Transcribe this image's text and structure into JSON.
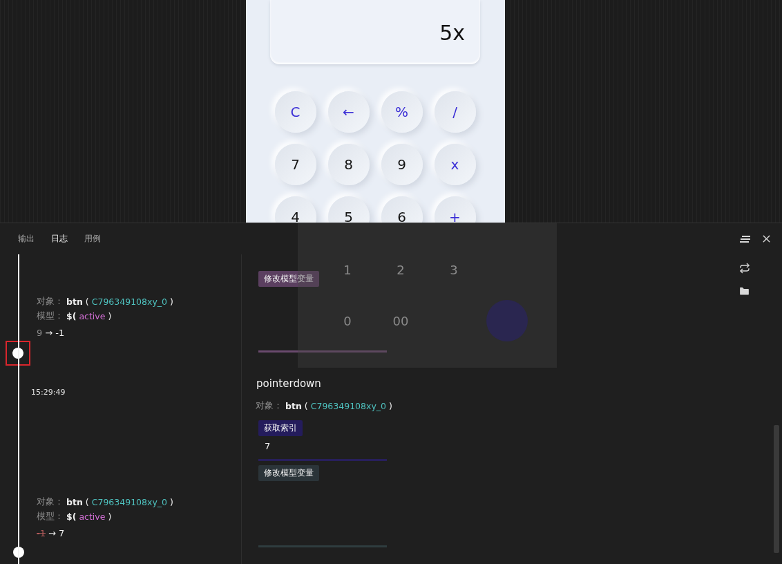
{
  "preview": {
    "display": "5x",
    "keys": [
      {
        "label": "C",
        "kind": "op"
      },
      {
        "label": "←",
        "kind": "op"
      },
      {
        "label": "%",
        "kind": "op"
      },
      {
        "label": "/",
        "kind": "op"
      },
      {
        "label": "7",
        "kind": "num"
      },
      {
        "label": "8",
        "kind": "num"
      },
      {
        "label": "9",
        "kind": "num"
      },
      {
        "label": "x",
        "kind": "op"
      },
      {
        "label": "4",
        "kind": "num"
      },
      {
        "label": "5",
        "kind": "num"
      },
      {
        "label": "6",
        "kind": "num"
      },
      {
        "label": "+",
        "kind": "op"
      }
    ],
    "ghost_keys": [
      {
        "label": "1",
        "kind": "num"
      },
      {
        "label": "2",
        "kind": "num"
      },
      {
        "label": "3",
        "kind": "num"
      },
      {
        "kind": "blank"
      },
      {
        "label": "0",
        "kind": "num"
      },
      {
        "label": "00",
        "kind": "num"
      },
      {
        "kind": "blank"
      },
      {
        "kind": "equals"
      }
    ]
  },
  "panel": {
    "tabs": [
      {
        "label": "输出",
        "selected": false
      },
      {
        "label": "日志",
        "selected": true
      },
      {
        "label": "用例",
        "selected": false
      }
    ],
    "timeline": [
      {
        "kind": "change",
        "object_label": "对象：",
        "object": "btn",
        "open": "(",
        "object_id": "C796349108xy_0",
        "close": ")",
        "model_label": "模型：",
        "model_open": "$(",
        "model": "active",
        "model_close": ")",
        "from": "9",
        "arrow": "→",
        "to": "-1",
        "from_struck": false
      },
      {
        "kind": "dot",
        "highlighted": true
      },
      {
        "kind": "time",
        "text": "15:29:49"
      },
      {
        "kind": "change",
        "object_label": "对象：",
        "object": "btn",
        "open": "(",
        "object_id": "C796349108xy_0",
        "close": ")",
        "model_label": "模型：",
        "model_open": "$(",
        "model": "active",
        "model_close": ")",
        "from": "-1",
        "arrow": "→",
        "to": "7",
        "from_struck": true
      },
      {
        "kind": "dot",
        "highlighted": false
      }
    ],
    "events": [
      {
        "kind": "tag",
        "label": "修改模型变量",
        "color": "#5b3f60"
      },
      {
        "kind": "bar",
        "color": "#6a4a6e"
      },
      {
        "kind": "title",
        "text": "pointerdown"
      },
      {
        "kind": "object",
        "label": "对象：",
        "object": "btn",
        "open": "(",
        "object_id": "C796349108xy_0",
        "close": ")"
      },
      {
        "kind": "tag",
        "label": "获取索引",
        "color": "#241c5c"
      },
      {
        "kind": "value",
        "text": "7"
      },
      {
        "kind": "bar",
        "color": "#271f5c"
      },
      {
        "kind": "tag",
        "label": "修改模型变量",
        "color": "#2b3439"
      },
      {
        "kind": "bar",
        "color": "#2f3d3f"
      }
    ]
  }
}
